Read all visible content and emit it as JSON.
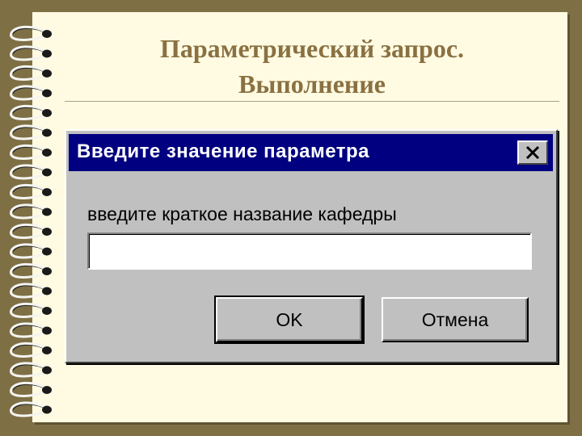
{
  "slide": {
    "title_line1": "Параметрический запрос.",
    "title_line2": "Выполнение"
  },
  "dialog": {
    "title": "Введите значение параметра",
    "prompt": "введите краткое название кафедры",
    "input_value": "",
    "ok_label": "OK",
    "cancel_label": "Отмена",
    "close_icon": "close-icon"
  },
  "colors": {
    "frame": "#7f6f45",
    "paper": "#fffbe2",
    "title_text": "#8a7142",
    "dialog_bg": "#c0c0c0",
    "titlebar": "#000080"
  }
}
